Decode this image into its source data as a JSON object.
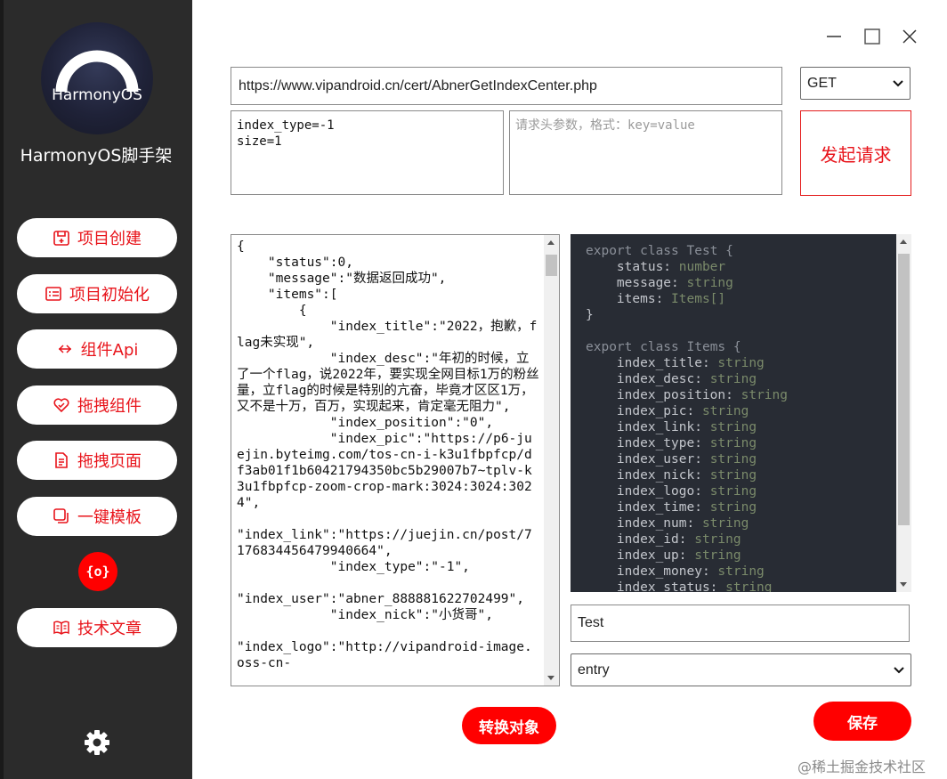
{
  "sidebar": {
    "logo_text": "HarmonyOS",
    "app_title": "HarmonyOS脚手架",
    "items": [
      {
        "label": "项目创建",
        "icon": "project-create-icon"
      },
      {
        "label": "项目初始化",
        "icon": "project-init-icon"
      },
      {
        "label": "组件Api",
        "icon": "component-api-icon"
      },
      {
        "label": "拖拽组件",
        "icon": "drag-component-icon"
      },
      {
        "label": "拖拽页面",
        "icon": "drag-page-icon"
      },
      {
        "label": "一键模板",
        "icon": "template-icon"
      }
    ],
    "round_icon_text": "{o}",
    "article_button": {
      "label": "技术文章",
      "icon": "book-icon"
    },
    "settings_icon": "gear-icon"
  },
  "window_controls": {
    "minimize": "minimize-icon",
    "maximize": "maximize-icon",
    "close": "close-icon"
  },
  "request": {
    "url": "https://www.vipandroid.cn/cert/AbnerGetIndexCenter.php",
    "method": "GET",
    "params": "index_type=-1\nsize=1",
    "headers_placeholder": "请求头参数，格式：key=value",
    "send_label": "发起请求"
  },
  "response": {
    "json_text": "{\n    \"status\":0,\n    \"message\":\"数据返回成功\",\n    \"items\":[\n        {\n            \"index_title\":\"2022，抱歉，flag未实现\",\n            \"index_desc\":\"年初的时候，立了一个flag，说2022年，要实现全网目标1万的粉丝量，立flag的时候是特别的亢奋，毕竟才区区1万，又不是十万，百万，实现起来，肯定毫无阻力\",\n            \"index_position\":\"0\",\n            \"index_pic\":\"https://p6-juejin.byteimg.com/tos-cn-i-k3u1fbpfcp/df3ab01f1b60421794350bc5b29007b7~tplv-k3u1fbpfcp-zoom-crop-mark:3024:3024:3024\",\n\n\"index_link\":\"https://juejin.cn/post/7176834456479940664\",\n            \"index_type\":\"-1\",\n\n\"index_user\":\"abner_888881622702499\",\n            \"index_nick\":\"小货哥\",\n\n\"index_logo\":\"http://vipandroid-image.oss-cn-"
  },
  "code": {
    "lines": [
      {
        "kw": "export class ",
        "name": "Test",
        "rest": " {"
      },
      {
        "prop": "    status: ",
        "ty": "number"
      },
      {
        "prop": "    message: ",
        "ty": "string"
      },
      {
        "prop": "    items: ",
        "ty": "Items[]"
      },
      {
        "br": "}"
      },
      {
        "br": ""
      },
      {
        "kw": "export class ",
        "name": "Items",
        "rest": " {"
      },
      {
        "prop": "    index_title: ",
        "ty": "string"
      },
      {
        "prop": "    index_desc: ",
        "ty": "string"
      },
      {
        "prop": "    index_position: ",
        "ty": "string"
      },
      {
        "prop": "    index_pic: ",
        "ty": "string"
      },
      {
        "prop": "    index_link: ",
        "ty": "string"
      },
      {
        "prop": "    index_type: ",
        "ty": "string"
      },
      {
        "prop": "    index_user: ",
        "ty": "string"
      },
      {
        "prop": "    index_nick: ",
        "ty": "string"
      },
      {
        "prop": "    index_logo: ",
        "ty": "string"
      },
      {
        "prop": "    index_time: ",
        "ty": "string"
      },
      {
        "prop": "    index_num: ",
        "ty": "string"
      },
      {
        "prop": "    index_id: ",
        "ty": "string"
      },
      {
        "prop": "    index_up: ",
        "ty": "string"
      },
      {
        "prop": "    index_money: ",
        "ty": "string"
      },
      {
        "prop": "    index_status: ",
        "ty": "string"
      }
    ],
    "class_name": "Test",
    "entry_option": "entry"
  },
  "actions": {
    "convert_label": "转换对象",
    "save_label": "保存"
  },
  "watermark": "@稀土掘金技术社区",
  "colors": {
    "accent": "#ff0000",
    "sidebar_bg": "#2b2b2b",
    "code_bg": "#282c34"
  }
}
